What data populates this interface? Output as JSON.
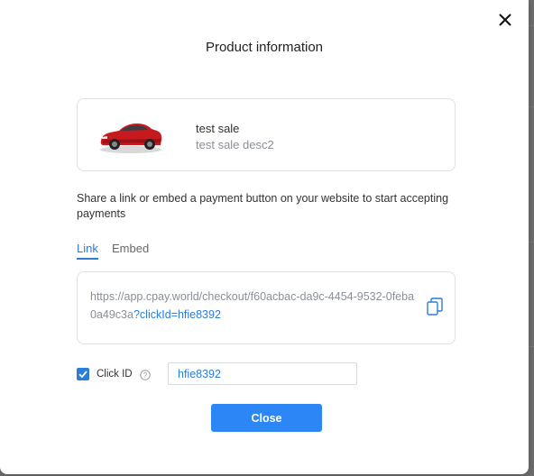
{
  "modal": {
    "title": "Product information",
    "close_button_label": "Close"
  },
  "product": {
    "name": "test sale",
    "description": "test sale desc2",
    "image_icon": "red-sedan-car"
  },
  "share": {
    "text": "Share a link or embed a payment button on your website to start accepting payments"
  },
  "tabs": [
    {
      "label": "Link",
      "active": true
    },
    {
      "label": "Embed",
      "active": false
    }
  ],
  "link": {
    "url_base": "https://app.cpay.world/checkout/f60acbac-da9c-4454-9532-0feba0a49c3a",
    "url_param": "?clickId=hfie8392",
    "copy_icon": "copy-icon"
  },
  "click_id": {
    "checked": true,
    "label": "Click ID",
    "value": "hfie8392",
    "help_icon": "question-circle-icon"
  },
  "colors": {
    "accent": "#2a7dd9",
    "button": "#2d86f5",
    "muted_text": "#8a8f98"
  }
}
